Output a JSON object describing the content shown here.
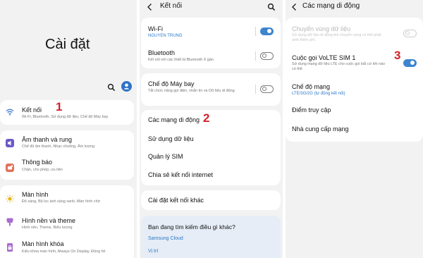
{
  "settings_home": {
    "title": "Cài đặt",
    "items": [
      {
        "label": "Kết nối",
        "sub": "Wi-Fi, Bluetooth, Sử dụng dữ liệu, Chế độ Máy bay",
        "icon": "wifi-icon",
        "marker": "1"
      },
      {
        "label": "Âm thanh và rung",
        "sub": "Chế độ âm thanh, Nhạc chuông, Âm lượng",
        "icon": "sound-icon"
      },
      {
        "label": "Thông báo",
        "sub": "Chặn, cho phép, ưu tiên",
        "icon": "notification-icon"
      },
      {
        "label": "Màn hình",
        "sub": "Độ sáng, Bộ lọc ánh sáng xanh, Màn hình chờ",
        "icon": "brightness-icon"
      },
      {
        "label": "Hình nền và theme",
        "sub": "Hình nền, Theme, Biểu tượng",
        "icon": "brush-icon"
      },
      {
        "label": "Màn hình khóa",
        "sub": "Kiểu khóa màn hình, Always On Display, Đồng hồ",
        "icon": "lock-screen-icon"
      }
    ]
  },
  "connections": {
    "title": "Kết nối",
    "wifi": {
      "label": "Wi-Fi",
      "value": "NGUYEN TRUNG",
      "on": true
    },
    "bluetooth": {
      "label": "Bluetooth",
      "sub": "Kết nối với các thiết bị Bluetooth ở gần.",
      "on": false
    },
    "airplane": {
      "label": "Chế độ Máy bay",
      "sub": "Tắt chức năng gọi điện, nhắn tin và Dữ liệu di động.",
      "on": false
    },
    "mobile_networks": {
      "label": "Các mạng di động",
      "marker": "2"
    },
    "data_usage": {
      "label": "Sử dụng dữ liệu"
    },
    "sim_manager": {
      "label": "Quản lý SIM"
    },
    "hotspot": {
      "label": "Chia sẻ kết nối internet"
    },
    "more": {
      "label": "Cài đặt kết nối khác"
    },
    "suggest": {
      "title": "Bạn đang tìm kiếm điều gì khác?",
      "link1": "Samsung Cloud",
      "link2": "Vị trí"
    }
  },
  "mobile_networks": {
    "title": "Các mạng di động",
    "roaming": {
      "label": "Chuyển vùng dữ liệu",
      "sub": "Sử dụng dữ liệu di động khi chuyển vùng có thể phát sinh thêm phí.",
      "on": false
    },
    "volte": {
      "label": "Cuộc gọi VoLTE SIM 1",
      "sub": "Sử dụng mạng dữ liệu LTE cho cuộc gọi bất cứ khi nào có thể.",
      "on": true,
      "marker": "3"
    },
    "network_mode": {
      "label": "Chế độ mạng",
      "value": "LTE/3G/2G (tự động kết nối)"
    },
    "apn": {
      "label": "Điểm truy cập"
    },
    "operators": {
      "label": "Nhà cung cấp mạng"
    }
  }
}
